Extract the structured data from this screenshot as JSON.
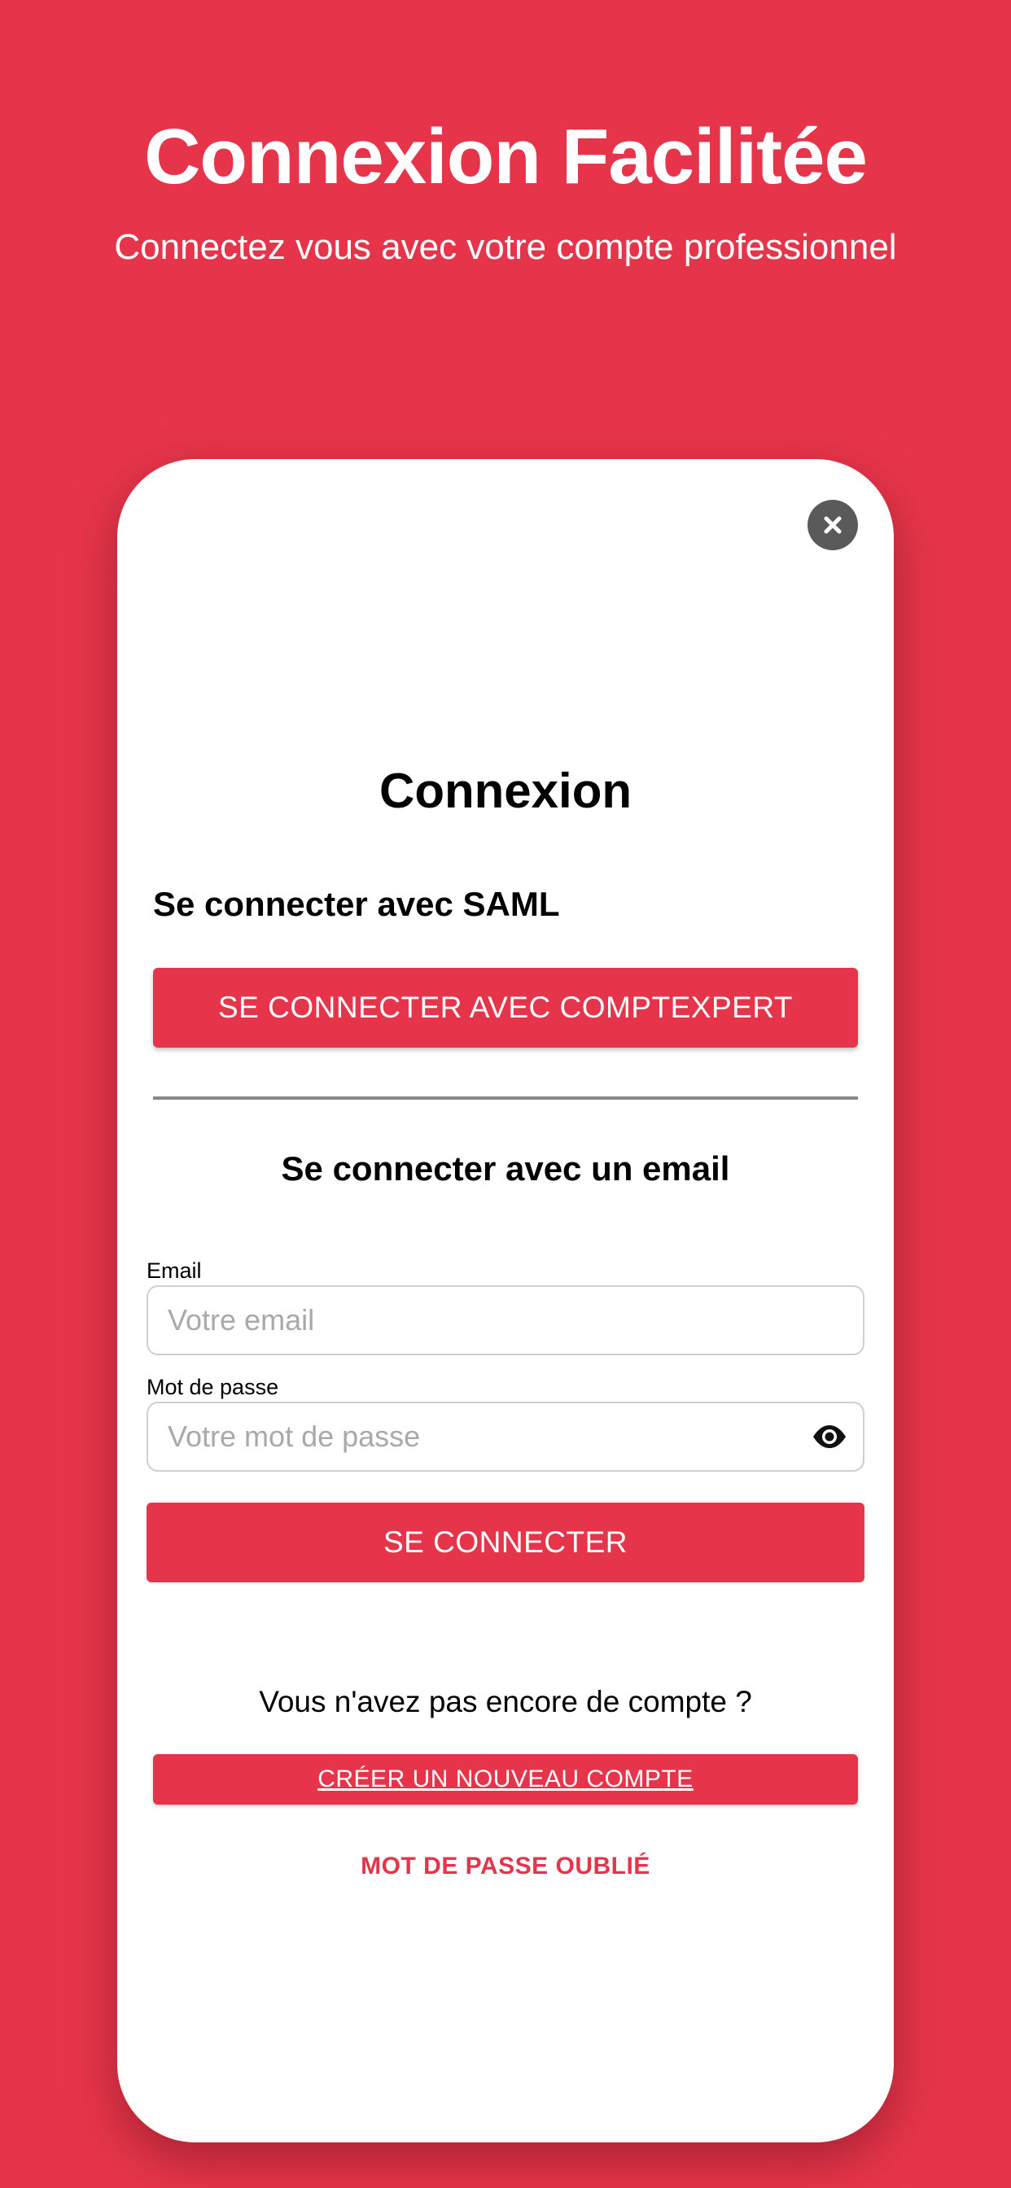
{
  "promo": {
    "title": "Connexion Facilitée",
    "subtitle": "Connectez vous avec votre compte professionnel"
  },
  "colors": {
    "brand": "#e6354a",
    "close_button": "#5a5a5a",
    "divider": "#888888"
  },
  "screen": {
    "close_icon": "close-icon",
    "title": "Connexion",
    "saml": {
      "heading": "Se connecter avec SAML",
      "button_label": "SE CONNECTER AVEC COMPTEXPERT"
    },
    "email_section": {
      "heading": "Se connecter avec un email",
      "email_label": "Email",
      "email_placeholder": "Votre email",
      "email_value": "",
      "password_label": "Mot de passe",
      "password_placeholder": "Votre mot de passe",
      "password_value": "",
      "password_toggle_icon": "eye-icon",
      "submit_label": "SE CONNECTER"
    },
    "no_account_text": "Vous n'avez pas encore de compte ?",
    "create_account_label": "CRÉER UN NOUVEAU COMPTE",
    "forgot_password_label": "MOT DE PASSE OUBLIÉ"
  }
}
